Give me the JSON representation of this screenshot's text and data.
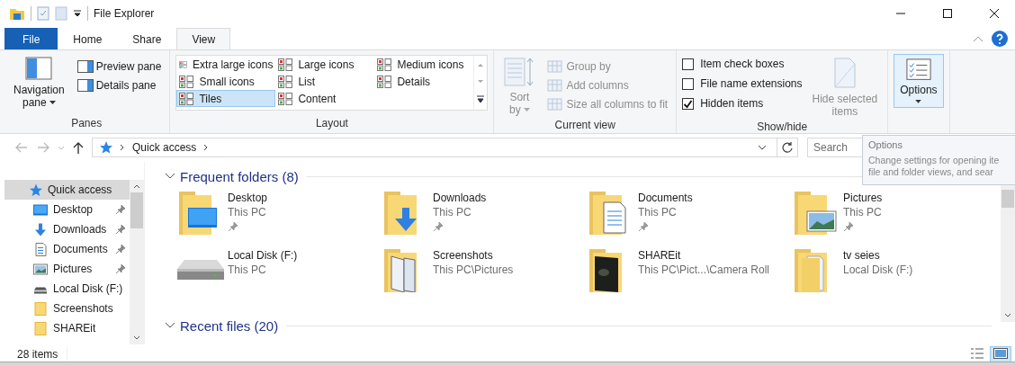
{
  "title_bar": {
    "title": "File Explorer"
  },
  "ribbon_tabs": [
    {
      "label": "File",
      "kind": "file",
      "selected": false
    },
    {
      "label": "Home",
      "kind": "tab",
      "selected": false
    },
    {
      "label": "Share",
      "kind": "tab",
      "selected": false
    },
    {
      "label": "View",
      "kind": "tab",
      "selected": true
    }
  ],
  "panes_group": {
    "label": "Panes",
    "navigation_pane": [
      "Navigation",
      "pane"
    ],
    "panes": [
      "Preview pane",
      "Details pane"
    ]
  },
  "layout_group": {
    "label": "Layout",
    "options": [
      {
        "label": "Extra large icons",
        "selected": false
      },
      {
        "label": "Large icons",
        "selected": false
      },
      {
        "label": "Medium icons",
        "selected": false
      },
      {
        "label": "Small icons",
        "selected": false
      },
      {
        "label": "List",
        "selected": false
      },
      {
        "label": "Details",
        "selected": false
      },
      {
        "label": "Tiles",
        "selected": true
      },
      {
        "label": "Content",
        "selected": false
      }
    ]
  },
  "current_view_group": {
    "label": "Current view",
    "disabled": true,
    "sort_by": [
      "Sort",
      "by"
    ],
    "items": [
      "Group by",
      "Add columns",
      "Size all columns to fit"
    ]
  },
  "show_hide_group": {
    "label": "Show/hide",
    "checkboxes": [
      {
        "label": "Item check boxes",
        "checked": false
      },
      {
        "label": "File name extensions",
        "checked": false
      },
      {
        "label": "Hidden items",
        "checked": true
      }
    ],
    "hide_selected": [
      "Hide selected",
      "items"
    ]
  },
  "options_button": {
    "label": "Options"
  },
  "address_bar": {
    "location": "Quick access"
  },
  "search": {
    "placeholder": "Search"
  },
  "tooltip": {
    "title": "Options",
    "lines": [
      "Change settings for opening ite",
      "file and folder views, and sear"
    ]
  },
  "sidebar": [
    {
      "label": "Quick access",
      "kind": "star",
      "selected": true,
      "pinned": false
    },
    {
      "label": "Desktop",
      "kind": "desktop",
      "selected": false,
      "pinned": true
    },
    {
      "label": "Downloads",
      "kind": "downloads",
      "selected": false,
      "pinned": true
    },
    {
      "label": "Documents",
      "kind": "documents",
      "selected": false,
      "pinned": true
    },
    {
      "label": "Pictures",
      "kind": "pictures",
      "selected": false,
      "pinned": true
    },
    {
      "label": "Local Disk (F:)",
      "kind": "disk",
      "selected": false,
      "pinned": false
    },
    {
      "label": "Screenshots",
      "kind": "folder",
      "selected": false,
      "pinned": false
    },
    {
      "label": "SHAREit",
      "kind": "folder",
      "selected": false,
      "pinned": false
    }
  ],
  "sections": [
    {
      "title": "Frequent folders (8)",
      "expanded": true,
      "items": [
        {
          "name": "Desktop",
          "location": "This PC",
          "kind": "desktop",
          "pinned": true
        },
        {
          "name": "Downloads",
          "location": "This PC",
          "kind": "downloads",
          "pinned": true
        },
        {
          "name": "Documents",
          "location": "This PC",
          "kind": "documents",
          "pinned": true
        },
        {
          "name": "Pictures",
          "location": "This PC",
          "kind": "pictures",
          "pinned": true
        },
        {
          "name": "Local Disk (F:)",
          "location": "This PC",
          "kind": "disk",
          "pinned": false
        },
        {
          "name": "Screenshots",
          "location": "This PC\\Pictures",
          "kind": "screenshots",
          "pinned": false
        },
        {
          "name": "SHAREit",
          "location": "This PC\\Pict...\\Camera Roll",
          "kind": "dark",
          "pinned": false
        },
        {
          "name": "tv seies",
          "location": "Local Disk (F:)",
          "kind": "folder",
          "pinned": false
        }
      ]
    },
    {
      "title": "Recent files (20)",
      "expanded": true
    }
  ],
  "status_bar": {
    "count": "28 items"
  },
  "view_toggles": [
    {
      "kind": "details",
      "selected": false
    },
    {
      "kind": "tiles",
      "selected": true
    }
  ]
}
